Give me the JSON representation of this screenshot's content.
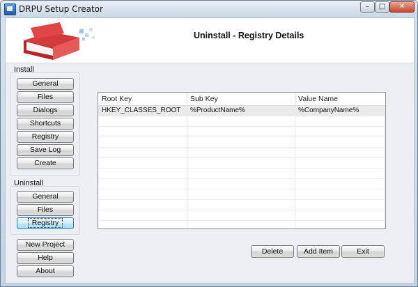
{
  "window": {
    "title": "DRPU Setup Creator",
    "minimize": "–",
    "maximize": "□",
    "close": "✕"
  },
  "header": {
    "title": "Uninstall - Registry Details",
    "logo_icon": "software-box-logo"
  },
  "install_group": {
    "label": "Install",
    "buttons": [
      "General",
      "Files",
      "Dialogs",
      "Shortcuts",
      "Registry",
      "Save Log",
      "Create"
    ]
  },
  "uninstall_group": {
    "label": "Uninstall",
    "buttons": [
      "General",
      "Files",
      "Registry"
    ],
    "active": "Registry"
  },
  "bottom_buttons": [
    "New Project",
    "Help",
    "About"
  ],
  "table": {
    "columns": [
      "Root Key",
      "Sub Key",
      "Value Name"
    ],
    "rows": [
      [
        "HKEY_CLASSES_ROOT",
        "%ProductName%",
        "%CompanyName%"
      ]
    ],
    "selected_row": 0
  },
  "actions": {
    "delete": "Delete",
    "add_item": "Add Item",
    "exit": "Exit"
  },
  "colors": {
    "accent": "#3c7fb1",
    "window_bg": "#eceff3",
    "close_red": "#c7472f"
  }
}
